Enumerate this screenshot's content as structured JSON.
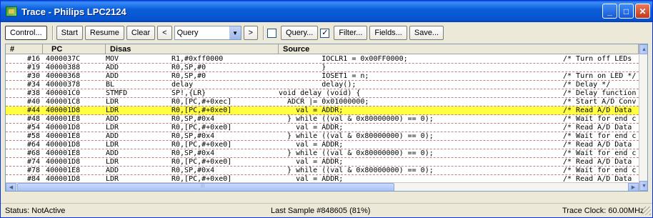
{
  "window": {
    "title": "Trace - Philips LPC2124",
    "minimize": "_",
    "maximize": "□",
    "close": "✕"
  },
  "toolbar": {
    "control": "Control...",
    "start": "Start",
    "resume": "Resume",
    "clear": "Clear",
    "prev": "<",
    "query_value": "Query",
    "next": ">",
    "query_check": "Query...",
    "filter_check": "Filter...",
    "filter_checked_mark": "✓",
    "fields": "Fields...",
    "save": "Save..."
  },
  "grid": {
    "columns": [
      "#",
      "PC",
      "Disas",
      "",
      "Source",
      ""
    ],
    "rows": [
      {
        "n": "#16",
        "pc": "4000037C",
        "op": "MOV",
        "args": "R1,#0xff0000",
        "src": "          IOCLR1 = 0x00FF0000;",
        "cmt": "/* Turn off LEDs"
      },
      {
        "n": "#19",
        "pc": "40000388",
        "op": "ADD",
        "args": "R0,SP,#0",
        "src": "          }",
        "cmt": ""
      },
      {
        "n": "#30",
        "pc": "40000368",
        "op": "ADD",
        "args": "R0,SP,#0",
        "src": "          IOSET1 = n;",
        "cmt": "/* Turn on LED */"
      },
      {
        "n": "#34",
        "pc": "40000378",
        "op": "BL",
        "args": "delay",
        "src": "          delay();",
        "cmt": "/* Delay */"
      },
      {
        "n": "#38",
        "pc": "400001C0",
        "op": "STMFD",
        "args": "SP!,{LR}",
        "src": "void delay (void) {",
        "cmt": "/* Delay function"
      },
      {
        "n": "#40",
        "pc": "400001C8",
        "op": "LDR",
        "args": "R0,[PC,#+0xec]",
        "src": "  ADCR |= 0x01000000;",
        "cmt": "/* Start A/D Conv"
      },
      {
        "n": "#44",
        "pc": "400001D8",
        "op": "LDR",
        "args": "R0,[PC,#+0xe0]",
        "src": "    val = ADDR;",
        "cmt": "/* Read A/D Data",
        "selected": true
      },
      {
        "n": "#48",
        "pc": "400001E8",
        "op": "ADD",
        "args": "R0,SP,#0x4",
        "src": "  } while ((val & 0x80000000) == 0);",
        "cmt": "/* Wait for end c"
      },
      {
        "n": "#54",
        "pc": "400001D8",
        "op": "LDR",
        "args": "R0,[PC,#+0xe0]",
        "src": "    val = ADDR;",
        "cmt": "/* Read A/D Data"
      },
      {
        "n": "#58",
        "pc": "400001E8",
        "op": "ADD",
        "args": "R0,SP,#0x4",
        "src": "  } while ((val & 0x80000000) == 0);",
        "cmt": "/* Wait for end c"
      },
      {
        "n": "#64",
        "pc": "400001D8",
        "op": "LDR",
        "args": "R0,[PC,#+0xe0]",
        "src": "    val = ADDR;",
        "cmt": "/* Read A/D Data"
      },
      {
        "n": "#68",
        "pc": "400001E8",
        "op": "ADD",
        "args": "R0,SP,#0x4",
        "src": "  } while ((val & 0x80000000) == 0);",
        "cmt": "/* Wait for end c"
      },
      {
        "n": "#74",
        "pc": "400001D8",
        "op": "LDR",
        "args": "R0,[PC,#+0xe0]",
        "src": "    val = ADDR;",
        "cmt": "/* Read A/D Data"
      },
      {
        "n": "#78",
        "pc": "400001E8",
        "op": "ADD",
        "args": "R0,SP,#0x4",
        "src": "  } while ((val & 0x80000000) == 0);",
        "cmt": "/* Wait for end c"
      },
      {
        "n": "#84",
        "pc": "400001D8",
        "op": "LDR",
        "args": "R0,[PC,#+0xe0]",
        "src": "    val = ADDR;",
        "cmt": "/* Read A/D Data"
      }
    ]
  },
  "status": {
    "left": "Status: NotActive",
    "middle": "Last Sample #848605 (81%)",
    "right": "Trace Clock: 60.00MHz"
  }
}
